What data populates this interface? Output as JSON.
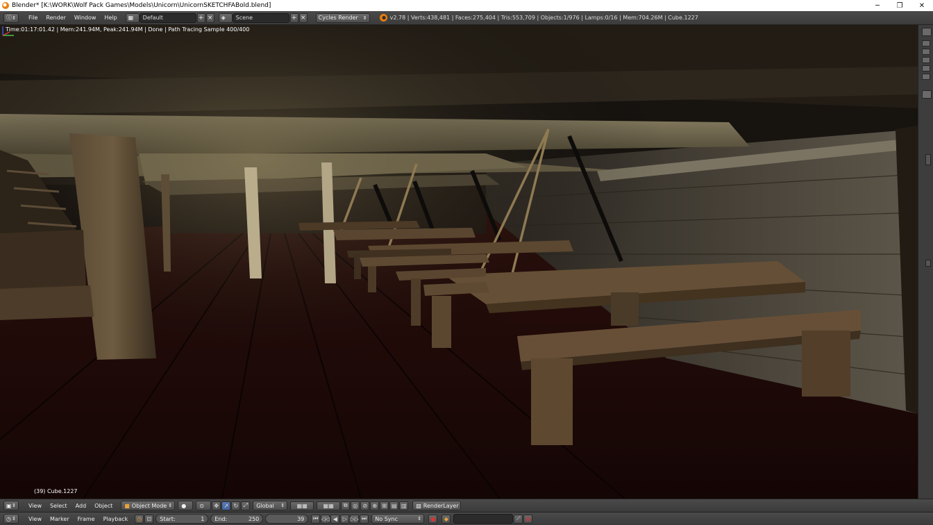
{
  "window": {
    "title": "Blender* [K:\\WORK\\Wolf Pack Games\\Models\\Unicorn\\UnicornSKETCHFABold.blend]",
    "minimize": "─",
    "maximize": "❐",
    "close": "✕"
  },
  "info_header": {
    "menu": [
      "File",
      "Render",
      "Window",
      "Help"
    ],
    "layout_value": "Default",
    "scene_value": "Scene",
    "render_engine": "Cycles Render",
    "stats": "v2.78 | Verts:438,481 | Faces:275,404 | Tris:553,709 | Objects:1/976 | Lamps:0/16 | Mem:704.26M | Cube.1227"
  },
  "viewport": {
    "status": "Time:01:17:01.42 | Mem:241.94M, Peak:241.94M | Done | Path Tracing Sample 400/400",
    "object_label": "(39) Cube.1227"
  },
  "view3d_header": {
    "menu": [
      "View",
      "Select",
      "Add",
      "Object"
    ],
    "mode": "Object Mode",
    "orientation": "Global",
    "render_layer": "RenderLayer"
  },
  "timeline_header": {
    "menu": [
      "View",
      "Marker",
      "Frame",
      "Playback"
    ],
    "start_label": "Start:",
    "start_value": "1",
    "end_label": "End:",
    "end_value": "250",
    "current_frame": "39",
    "sync": "No Sync"
  }
}
